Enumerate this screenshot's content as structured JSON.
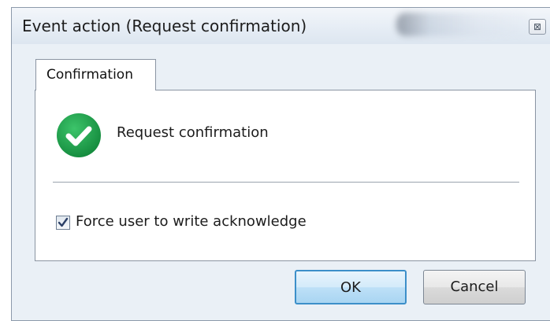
{
  "window": {
    "title": "Event action (Request confirmation)",
    "close_symbol": "⊠"
  },
  "tabs": [
    {
      "label": "Confirmation",
      "selected": true
    }
  ],
  "confirmation": {
    "icon": "success-check-icon",
    "label": "Request confirmation",
    "force_ack_label": "Force user to write acknowledge",
    "force_ack_checked": true
  },
  "buttons": {
    "ok_label": "OK",
    "cancel_label": "Cancel"
  },
  "colors": {
    "accent_green": "#1aa34a",
    "ok_border": "#3c8fc9"
  }
}
